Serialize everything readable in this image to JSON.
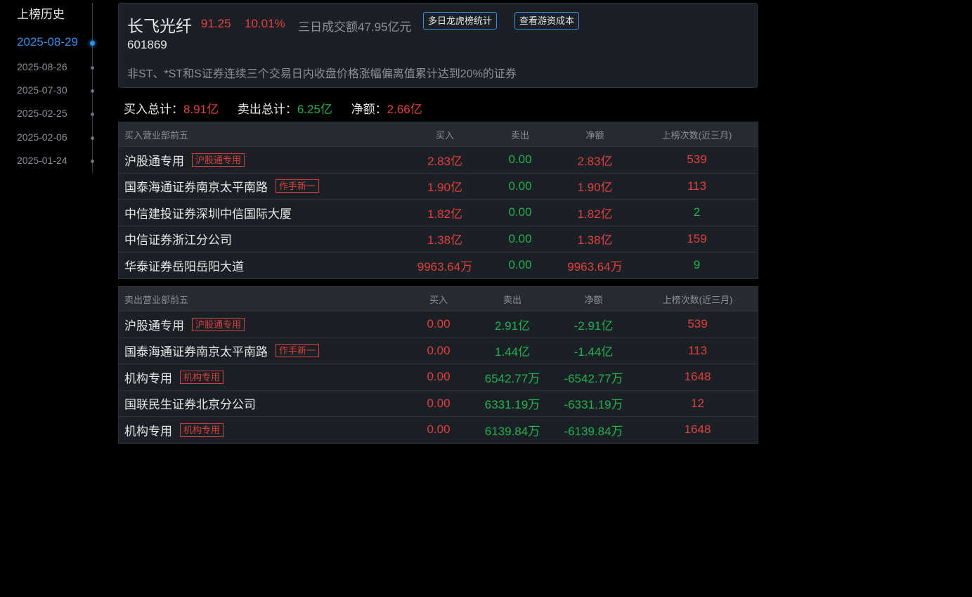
{
  "history": {
    "title": "上榜历史",
    "dates": [
      "2025-08-29",
      "2025-08-26",
      "2025-07-30",
      "2025-02-25",
      "2025-02-06",
      "2025-01-24"
    ],
    "active_index": 0
  },
  "header": {
    "name": "长飞光纤",
    "price": "91.25",
    "change_pct": "10.01%",
    "three_day_volume": "三日成交额47.95亿元",
    "btn_multi_day": "多日龙虎榜统计",
    "btn_cost": "查看游资成本",
    "code": "601869",
    "reason": "非ST、*ST和S证券连续三个交易日内收盘价格涨幅偏离值累计达到20%的证券"
  },
  "summary": {
    "buy_label": "买入总计：",
    "buy_value": "8.91亿",
    "sell_label": "卖出总计：",
    "sell_value": "6.25亿",
    "net_label": "净额：",
    "net_value": "2.66亿"
  },
  "buy_table": {
    "headers": [
      "买入营业部前五",
      "买入",
      "卖出",
      "净额",
      "上榜次数(近三月)"
    ],
    "rows": [
      {
        "name": "沪股通专用",
        "tag": "沪股通专用",
        "buy": "2.83亿",
        "sell": "0.00",
        "net": "2.83亿",
        "count": "539",
        "count_color": "red"
      },
      {
        "name": "国泰海通证券南京太平南路",
        "tag": "作手新一",
        "buy": "1.90亿",
        "sell": "0.00",
        "net": "1.90亿",
        "count": "113",
        "count_color": "red"
      },
      {
        "name": "中信建投证券深圳中信国际大厦",
        "tag": "",
        "buy": "1.82亿",
        "sell": "0.00",
        "net": "1.82亿",
        "count": "2",
        "count_color": "green"
      },
      {
        "name": "中信证券浙江分公司",
        "tag": "",
        "buy": "1.38亿",
        "sell": "0.00",
        "net": "1.38亿",
        "count": "159",
        "count_color": "red"
      },
      {
        "name": "华泰证券岳阳岳阳大道",
        "tag": "",
        "buy": "9963.64万",
        "sell": "0.00",
        "net": "9963.64万",
        "count": "9",
        "count_color": "green"
      }
    ]
  },
  "sell_table": {
    "headers": [
      "卖出营业部前五",
      "买入",
      "卖出",
      "净额",
      "上榜次数(近三月)"
    ],
    "rows": [
      {
        "name": "沪股通专用",
        "tag": "沪股通专用",
        "buy": "0.00",
        "sell": "2.91亿",
        "net": "-2.91亿",
        "count": "539",
        "count_color": "red"
      },
      {
        "name": "国泰海通证券南京太平南路",
        "tag": "作手新一",
        "buy": "0.00",
        "sell": "1.44亿",
        "net": "-1.44亿",
        "count": "113",
        "count_color": "red"
      },
      {
        "name": "机构专用",
        "tag": "机构专用",
        "buy": "0.00",
        "sell": "6542.77万",
        "net": "-6542.77万",
        "count": "1648",
        "count_color": "red"
      },
      {
        "name": "国联民生证券北京分公司",
        "tag": "",
        "buy": "0.00",
        "sell": "6331.19万",
        "net": "-6331.19万",
        "count": "12",
        "count_color": "red"
      },
      {
        "name": "机构专用",
        "tag": "机构专用",
        "buy": "0.00",
        "sell": "6139.84万",
        "net": "-6139.84万",
        "count": "1648",
        "count_color": "red"
      }
    ]
  },
  "colors": {
    "up": "#e0403c",
    "down": "#23b14d",
    "accent": "#2f8fe8",
    "background": "#000000",
    "panel": "#1b1f26"
  }
}
